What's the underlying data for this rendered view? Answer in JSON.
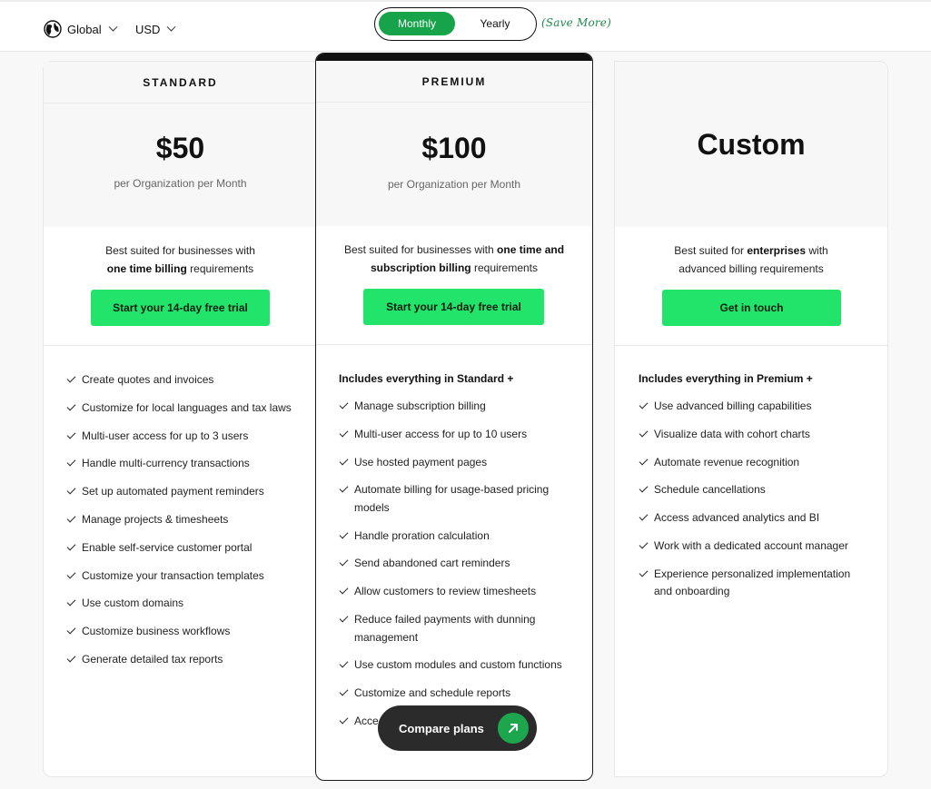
{
  "header": {
    "region_label": "Global",
    "currency_label": "USD",
    "billing_toggle": {
      "monthly": "Monthly",
      "yearly": "Yearly"
    },
    "save_more": "(Save More)"
  },
  "plans": {
    "standard": {
      "name": "STANDARD",
      "price": "$50",
      "per": "per Organization per Month",
      "desc_line1": "Best suited for businesses with",
      "desc_bold": "one time billing",
      "desc_rest": " requirements",
      "cta": "Start your 14-day free trial",
      "features": [
        "Create quotes and invoices",
        "Customize for local languages and tax laws",
        "Multi-user access for up to 3 users",
        "Handle multi-currency transactions",
        "Set up automated payment reminders",
        "Manage projects & timesheets",
        "Enable self-service customer portal",
        "Customize your transaction templates",
        "Use custom domains",
        "Customize business workflows",
        "Generate detailed tax reports"
      ]
    },
    "premium": {
      "name": "PREMIUM",
      "price": "$100",
      "per": "per Organization per Month",
      "desc_pre": "Best suited for businesses with ",
      "desc_bold1": "one time and",
      "desc_bold2": "subscription billing",
      "desc_rest": " requirements",
      "cta": "Start your 14-day free trial",
      "features_title": "Includes everything in Standard +",
      "features": [
        "Manage subscription billing",
        "Multi-user access for up to 10 users",
        "Use hosted payment pages",
        "Automate billing for usage-based pricing models",
        "Handle proration calculation",
        "Send abandoned cart reminders",
        "Allow customers to review timesheets",
        "Reduce failed payments with dunning management",
        "Use custom modules and custom functions",
        "Customize and schedule reports",
        "Acce"
      ]
    },
    "custom": {
      "price": "Custom",
      "desc_pre": "Best suited for ",
      "desc_bold": "enterprises",
      "desc_mid": " with",
      "desc_line2": "advanced billing requirements",
      "cta": "Get in touch",
      "features_title": "Includes everything in Premium +",
      "features": [
        "Use advanced billing capabilities",
        "Visualize data with cohort charts",
        "Automate revenue recognition",
        "Schedule cancellations",
        "Access advanced analytics and BI",
        "Work with a dedicated account manager",
        "Experience personalized implementation and onboarding"
      ]
    }
  },
  "compare_button": "Compare plans",
  "colors": {
    "accent_green": "#22e46b",
    "toggle_active": "#17a34a",
    "compare_bg": "#2b2b2b"
  }
}
